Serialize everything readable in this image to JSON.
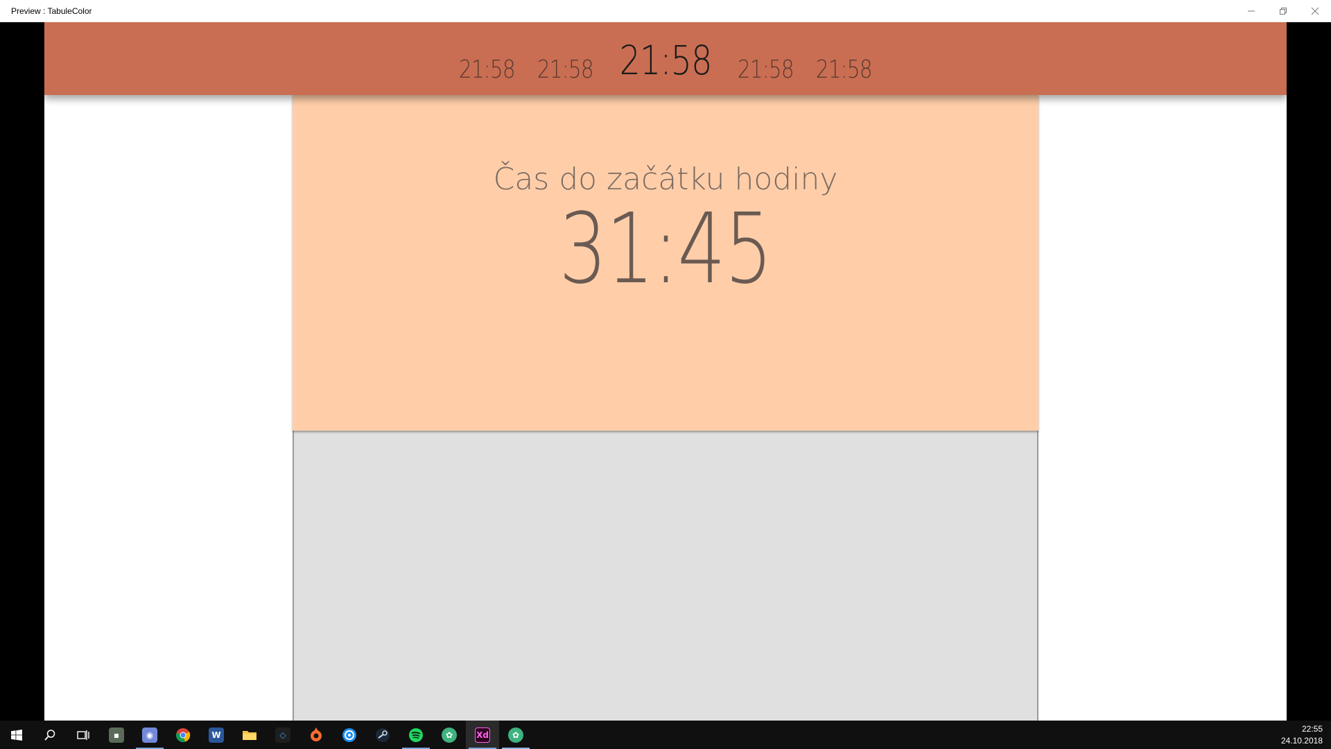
{
  "window": {
    "title": "Preview : TabuleColor"
  },
  "header": {
    "clocks": [
      "21:58",
      "21:58",
      "21:58",
      "21:58",
      "21:58"
    ],
    "current_index": 2
  },
  "card": {
    "label": "Čas do začátku hodiny",
    "countdown": "31:45"
  },
  "taskbar": {
    "items": [
      {
        "name": "start-icon"
      },
      {
        "name": "search-icon"
      },
      {
        "name": "task-view-icon"
      },
      {
        "name": "game-icon"
      },
      {
        "name": "discord-icon"
      },
      {
        "name": "chrome-icon"
      },
      {
        "name": "word-icon"
      },
      {
        "name": "file-explorer-icon"
      },
      {
        "name": "visual-studio-icon"
      },
      {
        "name": "origin-icon"
      },
      {
        "name": "uplay-icon"
      },
      {
        "name": "steam-icon"
      },
      {
        "name": "spotify-icon"
      },
      {
        "name": "app-green-icon"
      },
      {
        "name": "adobe-xd-icon"
      },
      {
        "name": "app-green-icon-2"
      }
    ],
    "clock_time": "22:55",
    "clock_date": "24.10.2018"
  },
  "colors": {
    "header": "#c96e52",
    "card": "#ffcea9",
    "lower": "#e0e0e0"
  }
}
